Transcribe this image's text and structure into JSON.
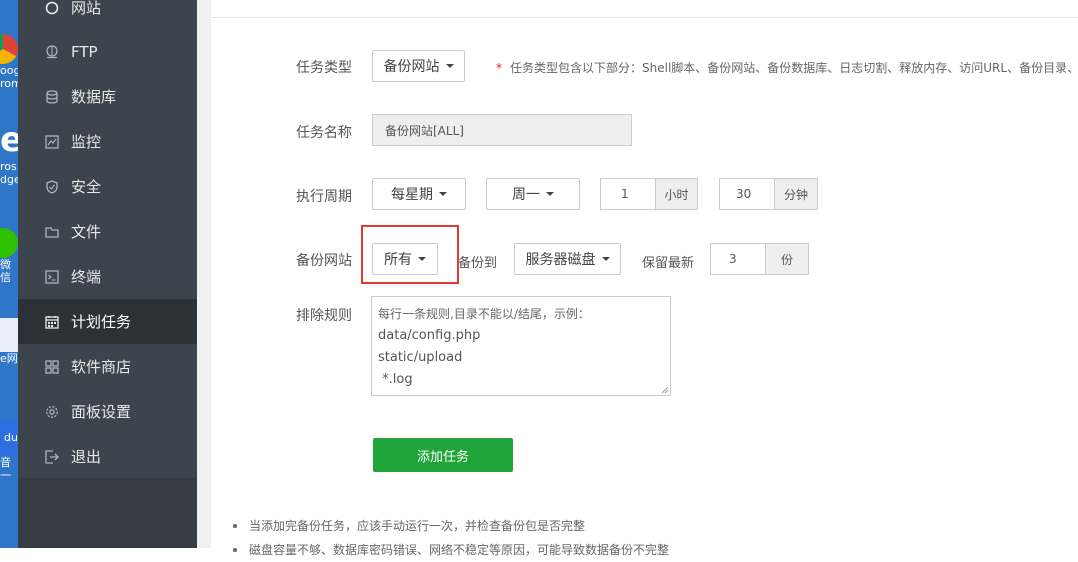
{
  "desktop": {
    "icons": [
      "oogl",
      "rom",
      "e",
      "ros",
      "dge",
      "微信",
      "e网",
      "du",
      "音一"
    ]
  },
  "sidebar": {
    "items": [
      {
        "label": "网站",
        "icon": "globe-icon"
      },
      {
        "label": "FTP",
        "icon": "ftp-icon"
      },
      {
        "label": "数据库",
        "icon": "database-icon"
      },
      {
        "label": "监控",
        "icon": "monitor-icon"
      },
      {
        "label": "安全",
        "icon": "shield-icon"
      },
      {
        "label": "文件",
        "icon": "folder-icon"
      },
      {
        "label": "终端",
        "icon": "terminal-icon"
      },
      {
        "label": "计划任务",
        "icon": "calendar-icon",
        "active": true
      },
      {
        "label": "软件商店",
        "icon": "grid-icon"
      },
      {
        "label": "面板设置",
        "icon": "gear-icon"
      },
      {
        "label": "退出",
        "icon": "logout-icon"
      }
    ]
  },
  "form": {
    "task_type": {
      "label": "任务类型",
      "value": "备份网站",
      "hint": "任务类型包含以下部分：Shell脚本、备份网站、备份数据库、日志切割、释放内存、访问URL、备份目录、",
      "hint_star": "*"
    },
    "task_name": {
      "label": "任务名称",
      "value": "备份网站[ALL]"
    },
    "period": {
      "label": "执行周期",
      "cycle": "每星期",
      "weekday": "周一",
      "hour": "1",
      "hour_unit": "小时",
      "minute": "30",
      "minute_unit": "分钟"
    },
    "backup_site": {
      "label": "备份网站",
      "value": "所有",
      "to_label": "备份到",
      "target": "服务器磁盘",
      "keep_label": "保留最新",
      "keep_count": "3",
      "keep_unit": "份"
    },
    "exclude": {
      "label": "排除规则",
      "placeholder": "每行一条规则,目录不能以/结尾，示例：",
      "lines": [
        "data/config.php",
        "static/upload",
        " *.log"
      ]
    },
    "submit": "添加任务"
  },
  "notes": [
    "当添加完备份任务，应该手动运行一次，并检查备份包是否完整",
    "磁盘容量不够、数据库密码错误、网络不稳定等原因，可能导致数据备份不完整"
  ],
  "colors": {
    "sidebar_bg": "#3c444d",
    "active_bg": "#2c3138",
    "primary": "#20a53a",
    "highlight": "#e53935"
  }
}
